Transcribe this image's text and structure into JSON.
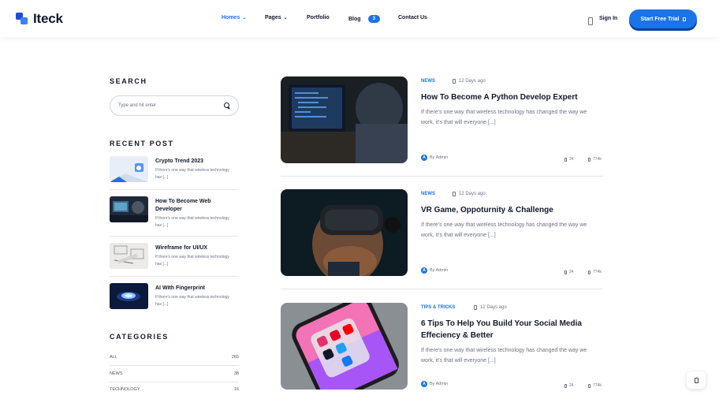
{
  "brand": {
    "name": "Iteck"
  },
  "nav": {
    "items": [
      {
        "label": "Homes",
        "has_dropdown": true,
        "active": true
      },
      {
        "label": "Pages",
        "has_dropdown": true,
        "active": false
      },
      {
        "label": "Portfolio",
        "has_dropdown": false,
        "active": false
      },
      {
        "label": "Blog",
        "badge": "3",
        "active": false
      },
      {
        "label": "Contact Us",
        "has_dropdown": false,
        "active": false
      }
    ],
    "signin_label": "Sign In",
    "trial_label": "Start Free Trial"
  },
  "sidebar": {
    "search": {
      "title": "SEARCH",
      "placeholder": "Type and hit enter"
    },
    "recent": {
      "title": "RECENT POST",
      "posts": [
        {
          "title": "Crypto Trend 2023",
          "excerpt": "If there's one way that wireless technology has [...]"
        },
        {
          "title": "How To Become Web Developer",
          "excerpt": "If there's one way that wireless technology has [...]"
        },
        {
          "title": "Wireframe for UI/UX",
          "excerpt": "If there's one way that wireless technology has [...]"
        },
        {
          "title": "AI With Fingerprint",
          "excerpt": "If there's one way that wireless technology has [...]"
        }
      ]
    },
    "categories": {
      "title": "CATEGORIES",
      "items": [
        {
          "name": "ALL",
          "count": "265"
        },
        {
          "name": "NEWS",
          "count": "38"
        },
        {
          "name": "TECHNOLOGY",
          "count": "16"
        }
      ]
    }
  },
  "posts": [
    {
      "tag": "NEWS",
      "date": "12 Days ago",
      "title": "How To Become A Python Develop Expert",
      "excerpt": "If there's one way that wireless technology has changed the way we work, it's that will everyone [...]",
      "author": "By Admin",
      "avatar_letter": "A",
      "comments": "24",
      "views": "774k"
    },
    {
      "tag": "NEWS",
      "date": "12 Days ago",
      "title": "VR Game, Oppoturnity & Challenge",
      "excerpt": "If there's one way that wireless technology has changed the way we work, it's that will everyone [...]",
      "author": "By Admin",
      "avatar_letter": "A",
      "comments": "24",
      "views": "774k"
    },
    {
      "tag": "TIPS & TRICKS",
      "date": "12 Days ago",
      "title": "6 Tips To Help You Build Your Social Media Effeciency & Better",
      "excerpt": "If there's one way that wireless technology has changed the way we work, it's that will everyone [...]",
      "author": "By Admin",
      "avatar_letter": "A",
      "comments": "24",
      "views": "774k"
    }
  ],
  "colors": {
    "accent": "#1a73e8",
    "text": "#111827",
    "muted": "#6b7280"
  }
}
